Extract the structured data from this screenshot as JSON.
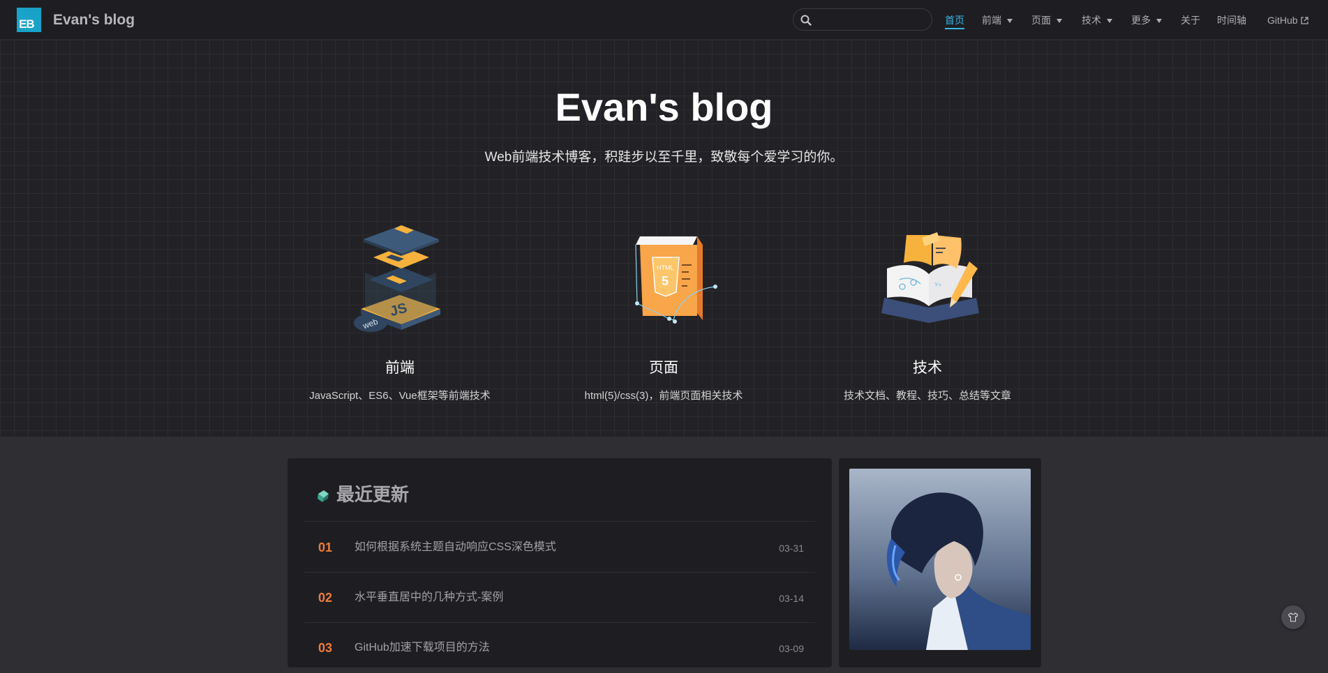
{
  "site": {
    "logo_text": "EB",
    "name": "Evan's blog"
  },
  "search": {
    "placeholder": "",
    "value": ""
  },
  "nav": [
    {
      "label": "首页",
      "active": true
    },
    {
      "label": "前端",
      "dropdown": true
    },
    {
      "label": "页面",
      "dropdown": true
    },
    {
      "label": "技术",
      "dropdown": true
    },
    {
      "label": "更多",
      "dropdown": true
    },
    {
      "label": "关于"
    },
    {
      "label": "时间轴"
    },
    {
      "label": "GitHub",
      "external": true
    }
  ],
  "hero": {
    "title": "Evan's blog",
    "description": "Web前端技术博客，积跬步以至千里，致敬每个爱学习的你。"
  },
  "features": [
    {
      "title": "前端",
      "desc": "JavaScript、ES6、Vue框架等前端技术",
      "icon": "javascript-stack-illustration"
    },
    {
      "title": "页面",
      "desc": "html(5)/css(3)，前端页面相关技术",
      "icon": "html5-page-illustration"
    },
    {
      "title": "技术",
      "desc": "技术文档、教程、技巧、总结等文章",
      "icon": "open-book-pencil-illustration"
    }
  ],
  "recent": {
    "title": "最近更新",
    "posts": [
      {
        "num": "01",
        "title": "如何根据系统主题自动响应CSS深色模式",
        "date": "03-31"
      },
      {
        "num": "02",
        "title": "水平垂直居中的几种方式-案例",
        "date": "03-14"
      },
      {
        "num": "03",
        "title": "GitHub加速下载项目的方法",
        "date": "03-09"
      }
    ]
  },
  "colors": {
    "accent": "#3ab6e6",
    "number": "#ee7d3a",
    "logo_bg": "#1aa3c9"
  }
}
